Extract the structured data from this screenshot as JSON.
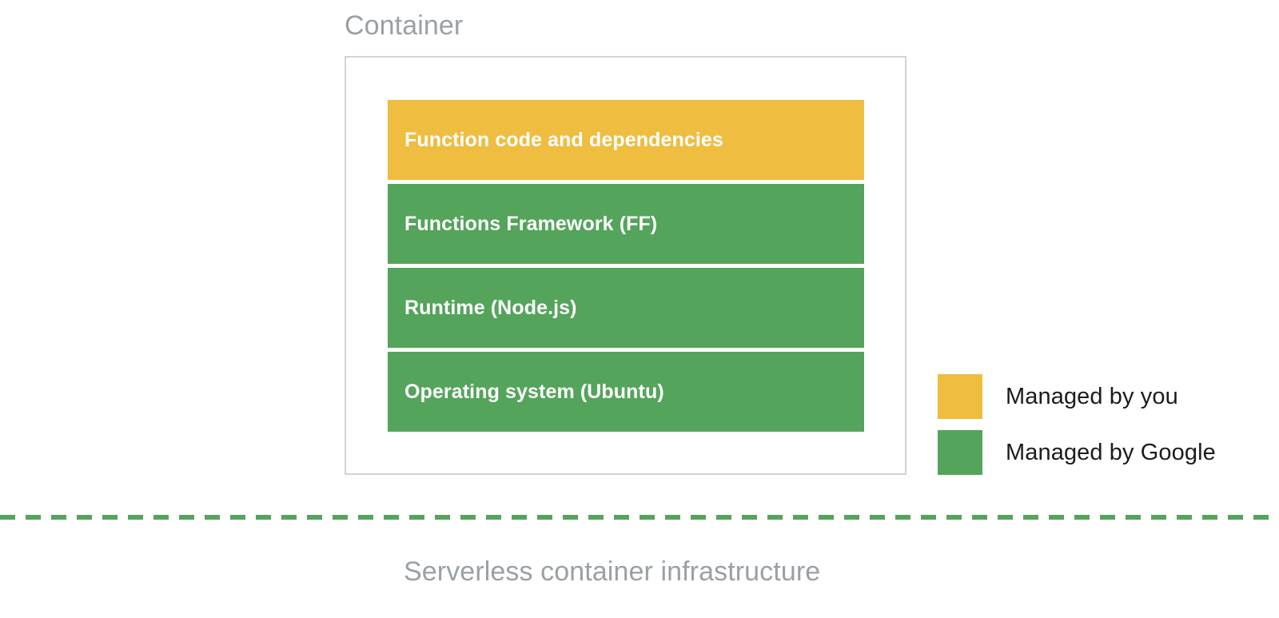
{
  "diagram": {
    "title": "Container",
    "caption": "Serverless container infrastructure",
    "colors": {
      "managed_by_you": "#efbd3f",
      "managed_by_google": "#54a45c",
      "container_border": "#d0d4d7",
      "title_text": "#9aa0a4",
      "caption_text": "#9aa0a4",
      "legend_text": "#1b1c1d",
      "divider": "#54a45c",
      "background": "#ffffff"
    },
    "layers": [
      {
        "label": "Function code and dependencies",
        "owner": "managed_by_you",
        "color": "#efbd3f"
      },
      {
        "label": "Functions Framework (FF)",
        "owner": "managed_by_google",
        "color": "#54a45c"
      },
      {
        "label": "Runtime (Node.js)",
        "owner": "managed_by_google",
        "color": "#54a45c"
      },
      {
        "label": "Operating system (Ubuntu)",
        "owner": "managed_by_google",
        "color": "#54a45c"
      }
    ],
    "legend": [
      {
        "label": "Managed by you",
        "color": "#efbd3f"
      },
      {
        "label": "Managed by Google",
        "color": "#54a45c"
      }
    ],
    "divider": {
      "style": "dashed",
      "color": "#54a45c",
      "dash_length": 19,
      "gap_length": 13,
      "thickness": 6
    }
  }
}
